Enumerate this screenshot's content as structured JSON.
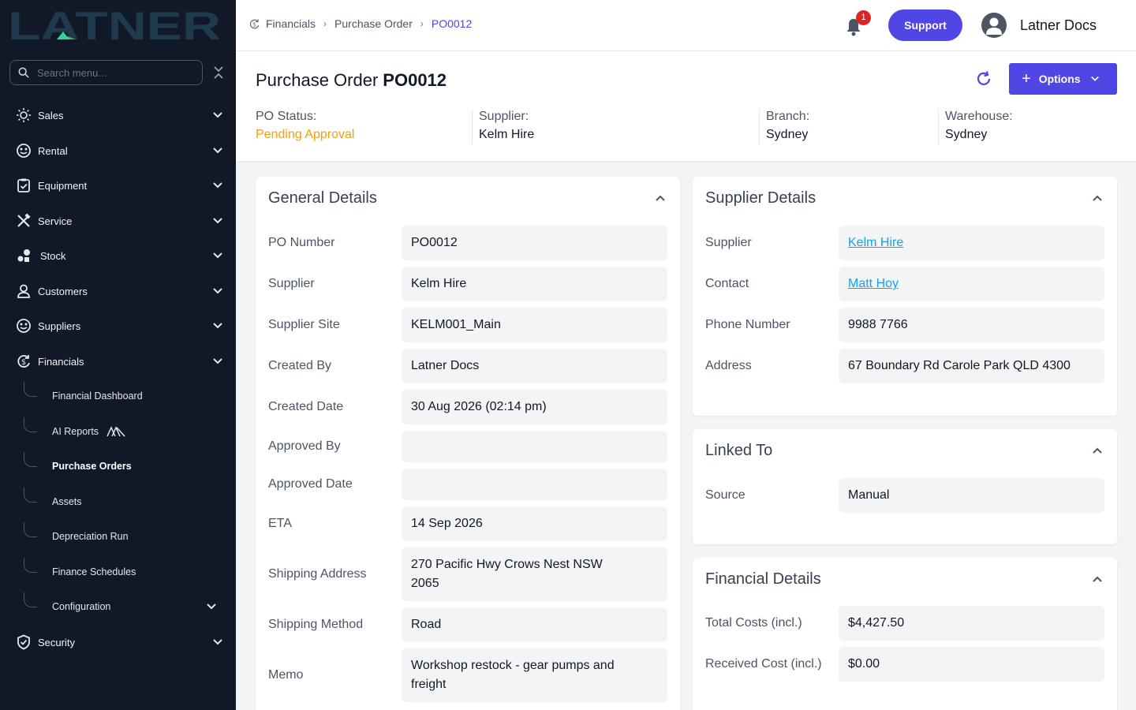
{
  "brand": {
    "logo_text": "LATNER"
  },
  "search": {
    "placeholder": "Search menu..."
  },
  "sidebar": {
    "items": [
      {
        "label": "Sales"
      },
      {
        "label": "Rental"
      },
      {
        "label": "Equipment"
      },
      {
        "label": "Service"
      },
      {
        "label": "Stock"
      },
      {
        "label": "Customers"
      },
      {
        "label": "Suppliers"
      },
      {
        "label": "Financials"
      },
      {
        "label": "Security"
      }
    ],
    "financials_sub": [
      {
        "label": "Financial Dashboard"
      },
      {
        "label": "AI Reports"
      },
      {
        "label": "Purchase Orders"
      },
      {
        "label": "Assets"
      },
      {
        "label": "Depreciation Run"
      },
      {
        "label": "Finance Schedules"
      },
      {
        "label": "Configuration"
      }
    ]
  },
  "breadcrumb": [
    "Financials",
    "Purchase Order",
    "PO0012"
  ],
  "header": {
    "notification_count": "1",
    "support_label": "Support",
    "user_name": "Latner Docs"
  },
  "page": {
    "title_prefix": "Purchase Order",
    "title_id": "PO0012",
    "options_label": "Options",
    "meta": [
      {
        "label": "PO Status:",
        "value": "Pending Approval"
      },
      {
        "label": "Supplier:",
        "value": "Kelm Hire"
      },
      {
        "label": "Branch:",
        "value": "Sydney"
      },
      {
        "label": "Warehouse:",
        "value": "Sydney"
      }
    ]
  },
  "general": {
    "title": "General Details",
    "rows": [
      {
        "label": "PO Number",
        "value": "PO0012"
      },
      {
        "label": "Supplier",
        "value": "Kelm Hire"
      },
      {
        "label": "Supplier Site",
        "value": "KELM001_Main"
      },
      {
        "label": "Created By",
        "value": "Latner Docs"
      },
      {
        "label": "Created Date",
        "value": "30 Aug 2026 (02:14 pm)"
      },
      {
        "label": "Approved By",
        "value": ""
      },
      {
        "label": "Approved Date",
        "value": ""
      },
      {
        "label": "ETA",
        "value": "14 Sep 2026"
      },
      {
        "label": "Shipping Address",
        "value": "270 Pacific Hwy Crows Nest NSW 2065"
      },
      {
        "label": "Shipping Method",
        "value": "Road"
      },
      {
        "label": "Memo",
        "value": "Workshop restock - gear pumps and freight"
      }
    ]
  },
  "supplier_details": {
    "title": "Supplier Details",
    "rows": [
      {
        "label": "Supplier",
        "value": "Kelm Hire"
      },
      {
        "label": "Contact",
        "value": "Matt Hoy"
      },
      {
        "label": "Phone Number",
        "value": "9988 7766"
      },
      {
        "label": "Address",
        "value": "67 Boundary Rd Carole Park QLD 4300"
      }
    ]
  },
  "linked": {
    "title": "Linked To",
    "rows": [
      {
        "label": "Source",
        "value": "Manual"
      }
    ]
  },
  "financial": {
    "title": "Financial Details",
    "rows": [
      {
        "label": "Total Costs (incl.)",
        "value": "$4,427.50"
      },
      {
        "label": "Received Cost (incl.)",
        "value": "$0.00"
      }
    ]
  },
  "colors": {
    "sidebar_bg": "#111827",
    "accent": "#4f46e5",
    "status_pending": "#f59e0b",
    "link": "#0ea5e9",
    "badge": "#dc2626"
  }
}
